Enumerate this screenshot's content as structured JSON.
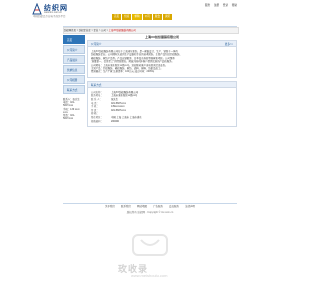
{
  "header": {
    "site_name": "纺织网",
    "site_url": "www.tnc.com.cn",
    "slogan": "中国纺织品专业电子商务平台",
    "top_links": [
      "服务",
      "注册",
      "登录",
      "帮助"
    ]
  },
  "nav": {
    "items": [
      "首页",
      "供应",
      "求购",
      "公司",
      "展会",
      "资讯"
    ],
    "active_index": 2
  },
  "breadcrumb": {
    "home": "纺织网首页",
    "path": [
      "纺织企业库",
      "企业",
      "公司"
    ],
    "current": "上海XX纺织服装有限公司"
  },
  "sidebar": {
    "items": [
      "首页",
      "公司简介",
      "产品展示",
      "供求信息",
      "公司相册",
      "联系方式"
    ],
    "active_index": 0,
    "contact_lines": [
      "联系人：张先生",
      "电话：021-5827xxxx",
      "手机：139 xxxx xxxx",
      "传真：021-5827xxxx"
    ]
  },
  "main": {
    "company_title": "上海XX纺织服装有限公司",
    "intro_panel": {
      "title": "公司简介",
      "more": "更多>>",
      "lines": [
        "上海XX纺织服装有限公司位于上海浦东新区，是一家集设计、生产、销售于一体的",
        "纺织服装企业，公司拥有先进的生产设备和专业的技术团队，主要产品包括针织服装、",
        "梭织服装、家纺产品等，产品远销欧美、日本及东南亚等国家和地区。公司秉承",
        "“质量第一、信誉至上”的经营理念，竭诚为国内外客户提供优质的产品和服务。",
        "公司地址：上海市浦东新区xx路xx号，欢迎新老客户来电咨询洽谈业务。",
        "主营产品：针织服装、梭织服装、家纺、面料、辅料、纺织品加工。",
        "经营模式：生产厂家  注册资本：100万元  成立时间：2005年"
      ]
    },
    "contact_panel": {
      "title": "联系方式",
      "rows": [
        {
          "k": "公司名称：",
          "v": "上海XX纺织服装有限公司"
        },
        {
          "k": "联系地址：",
          "v": "上海市浦东新区xx路xx号"
        },
        {
          "k": "联 系 人：",
          "v": "张先生"
        },
        {
          "k": "电   话：",
          "v": "021-5827xxxx"
        },
        {
          "k": "手   机：",
          "v": "139xxxxxxxx"
        },
        {
          "k": "传   真：",
          "v": "021-5827xxxx"
        },
        {
          "k": "邮   箱：",
          "v": ""
        },
        {
          "k": "所在地区：",
          "v": "中国 上海 上海市 上海市浦东"
        },
        {
          "k": "邮政编码：",
          "v": "200000"
        }
      ]
    }
  },
  "footer": {
    "links": [
      "关于我们",
      "联系我们",
      "网站地图",
      "广告服务",
      "会员服务",
      "法律声明"
    ],
    "copyright": "版权所有 纺织网 · Copyright © tnc.com.cn"
  },
  "watermark": {
    "text": "玫收录",
    "url": "www.meishoulu.com"
  },
  "colors": {
    "brand_blue": "#1f5a96",
    "nav_gold": "#d9a800",
    "active_blue": "#2e75b8",
    "highlight_red": "#c80000"
  }
}
